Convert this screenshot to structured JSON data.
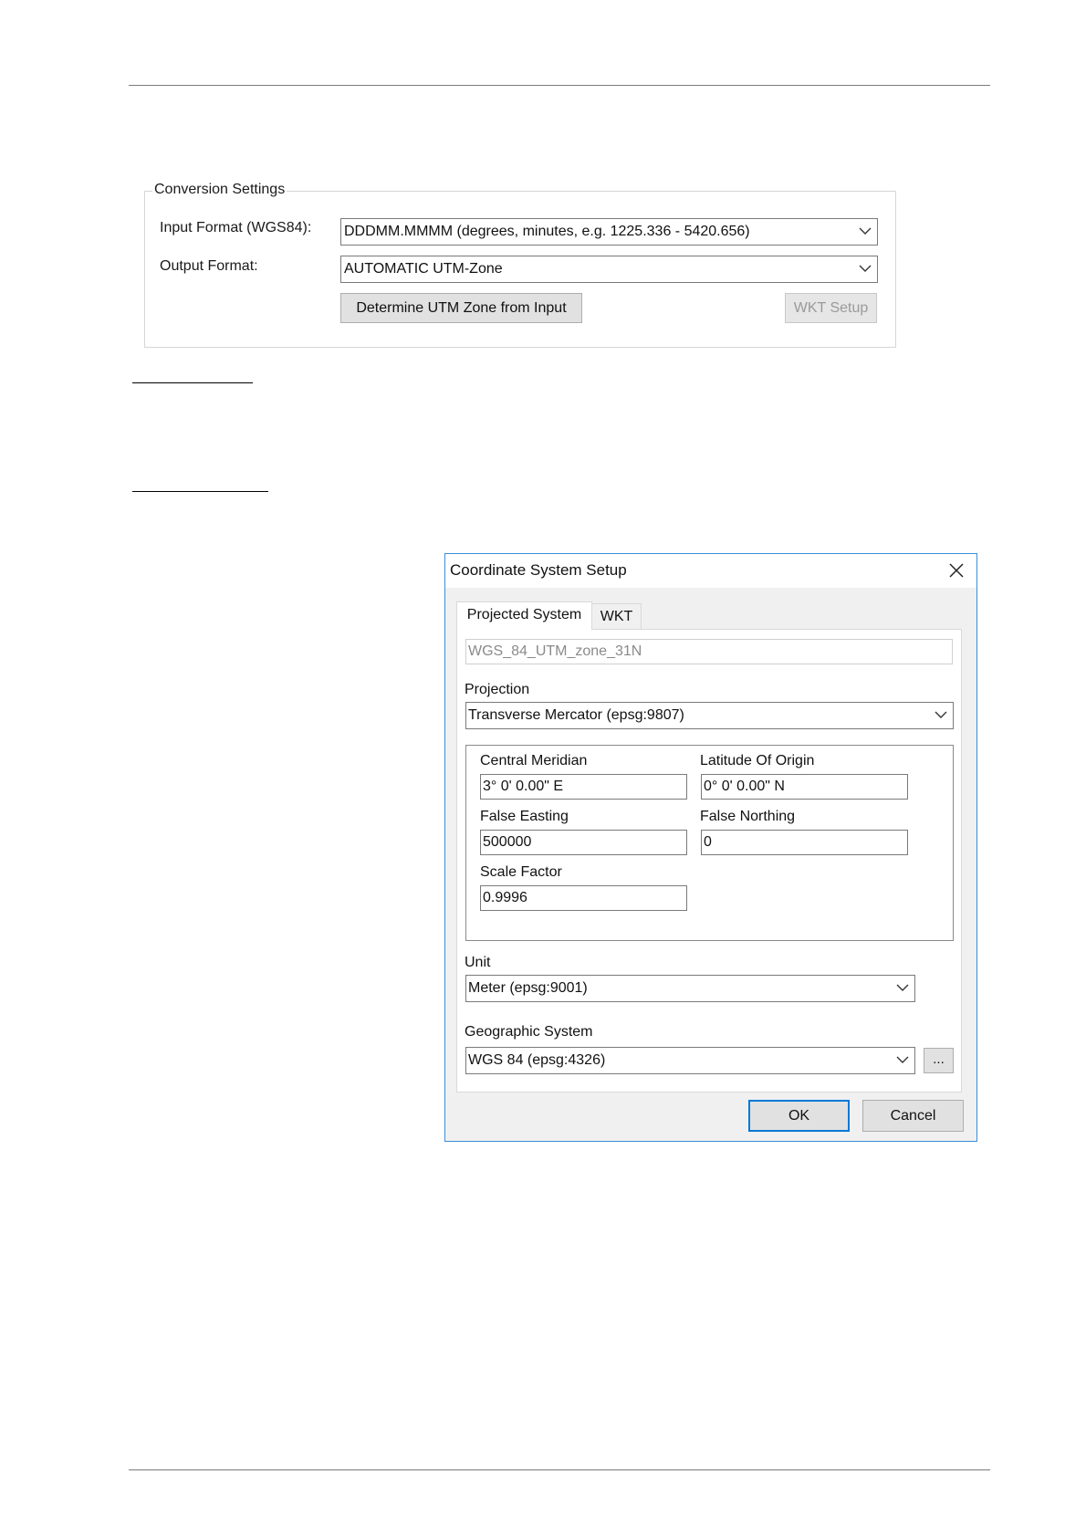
{
  "conversion_settings": {
    "legend": "Conversion Settings",
    "input_format_label": "Input Format (WGS84):",
    "input_format_value": "DDDMM.MMMM  (degrees, minutes, e.g. 1225.336 - 5420.656)",
    "output_format_label": "Output Format:",
    "output_format_value": "AUTOMATIC UTM-Zone",
    "determine_button": "Determine UTM Zone from Input",
    "wkt_setup_button": "WKT Setup"
  },
  "dialog": {
    "title": "Coordinate System Setup",
    "tabs": [
      "Projected System",
      "WKT"
    ],
    "name_value": "WGS_84_UTM_zone_31N",
    "projection_label": "Projection",
    "projection_value": "Transverse Mercator (epsg:9807)",
    "params": {
      "central_meridian_label": "Central Meridian",
      "central_meridian_value": "3° 0' 0.00\" E",
      "latitude_origin_label": "Latitude Of Origin",
      "latitude_origin_value": "0° 0' 0.00\" N",
      "false_easting_label": "False Easting",
      "false_easting_value": "500000",
      "false_northing_label": "False Northing",
      "false_northing_value": "0",
      "scale_factor_label": "Scale Factor",
      "scale_factor_value": "0.9996"
    },
    "unit_label": "Unit",
    "unit_value": "Meter (epsg:9001)",
    "geographic_label": "Geographic System",
    "geographic_value": "WGS 84 (epsg:4326)",
    "ellipsis_button": "...",
    "ok_button": "OK",
    "cancel_button": "Cancel"
  },
  "colors": {
    "dialog_border": "#3a8fd9",
    "default_button_border": "#0078d7",
    "button_face": "#e1e1e1"
  },
  "icons": [
    "chevron-down-icon",
    "close-icon"
  ]
}
